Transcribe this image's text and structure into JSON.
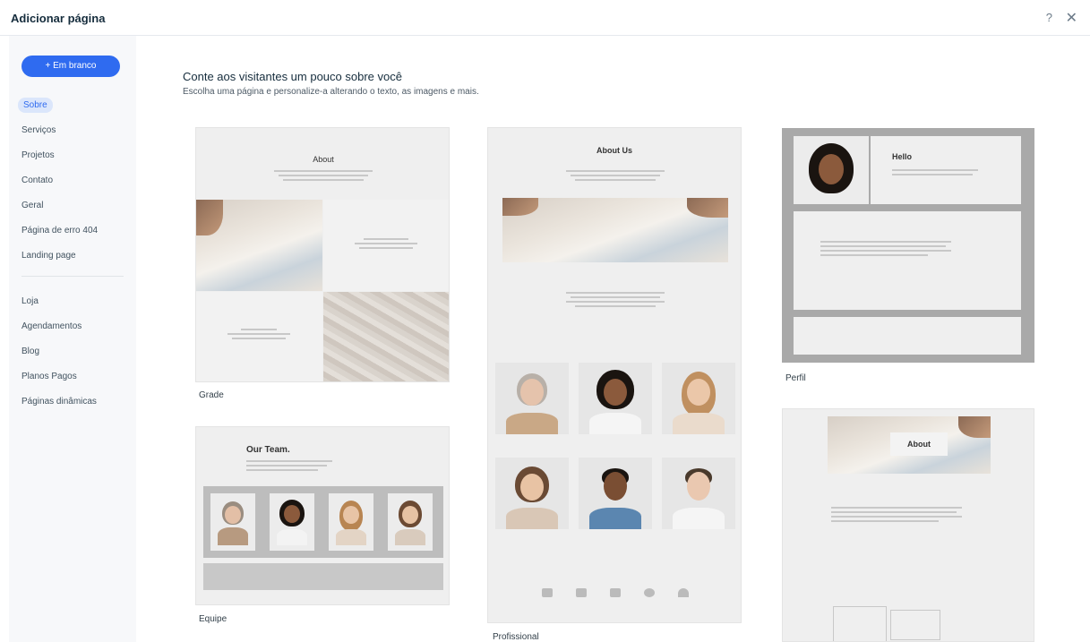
{
  "header": {
    "title": "Adicionar página",
    "help_icon": "?",
    "close_icon": "✕"
  },
  "sidebar": {
    "blank_button": "+ Em branco",
    "items": [
      {
        "label": "Sobre",
        "active": true
      },
      {
        "label": "Serviços"
      },
      {
        "label": "Projetos"
      },
      {
        "label": "Contato"
      },
      {
        "label": "Geral"
      },
      {
        "label": "Página de erro 404"
      },
      {
        "label": "Landing page"
      }
    ],
    "apps": [
      {
        "label": "Loja"
      },
      {
        "label": "Agendamentos"
      },
      {
        "label": "Blog"
      },
      {
        "label": "Planos Pagos"
      },
      {
        "label": "Páginas dinâmicas"
      }
    ]
  },
  "main": {
    "heading": "Conte aos visitantes um pouco sobre você",
    "subheading": "Escolha uma página e personalize-a alterando o texto, as imagens e mais.",
    "templates": [
      {
        "name": "Grade",
        "preview_title": "About"
      },
      {
        "name": "Equipe",
        "preview_title": "Our Team."
      },
      {
        "name": "Profissional",
        "preview_title": "About Us"
      },
      {
        "name": "Perfil",
        "preview_title": "Hello"
      },
      {
        "name": "",
        "preview_title": "About"
      }
    ]
  },
  "colors": {
    "accent": "#2f6bf0",
    "active_bg": "#dbe6fb",
    "sidebar_bg": "#f7f8fa"
  }
}
